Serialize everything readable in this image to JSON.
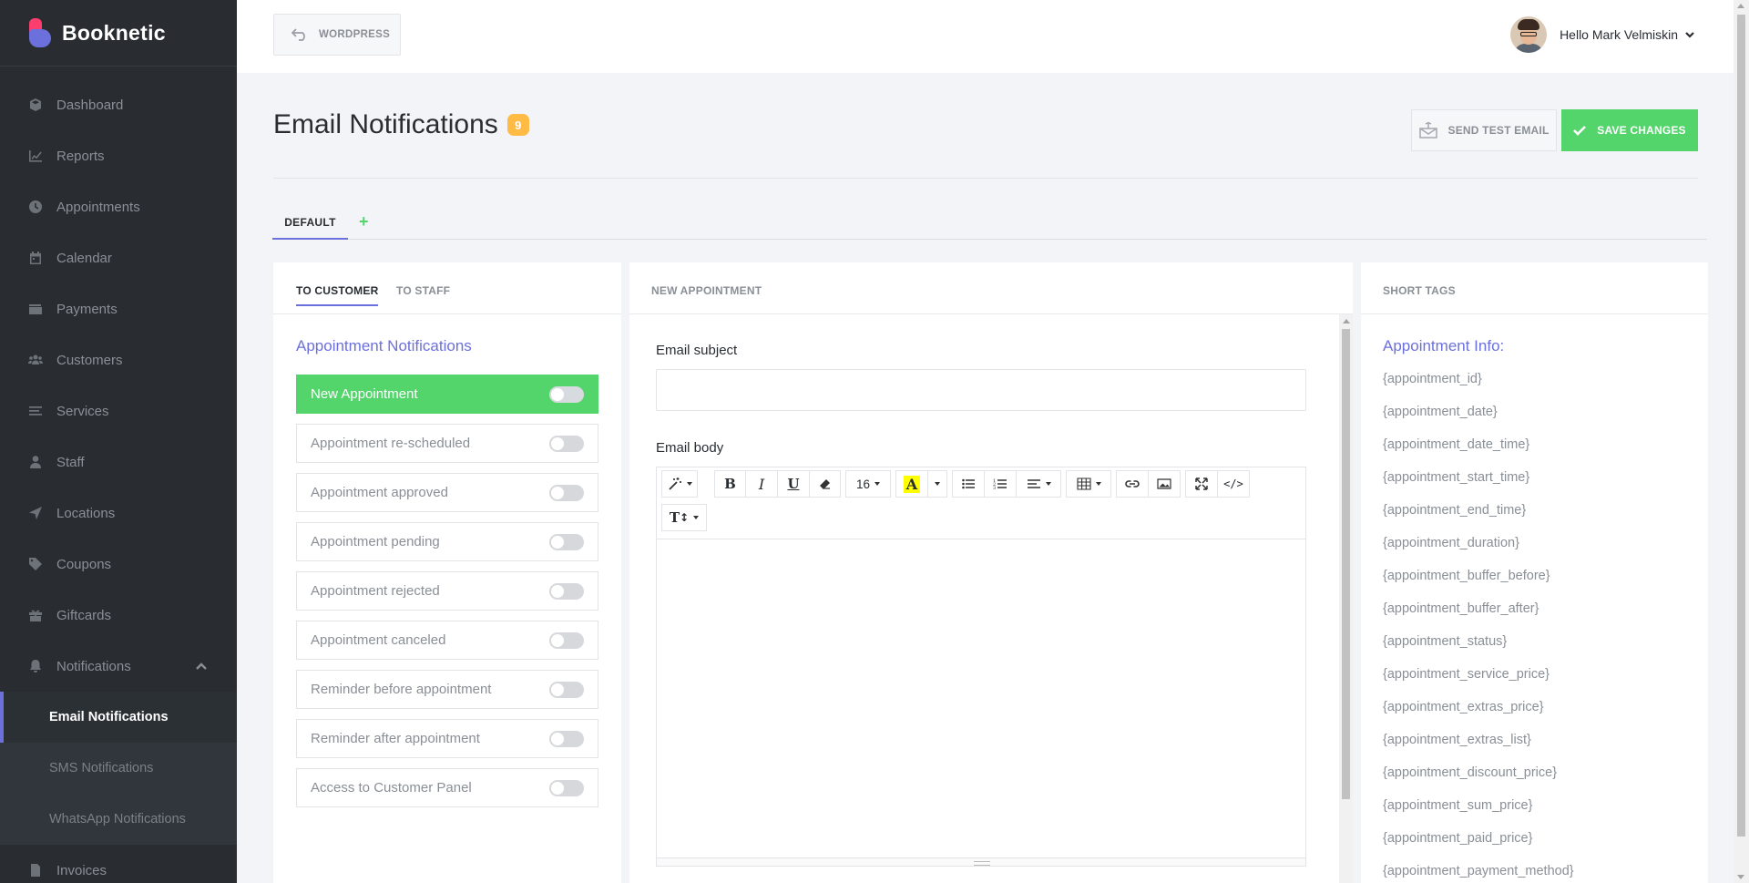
{
  "brand": {
    "name": "Booknetic"
  },
  "sidebar": {
    "items": [
      {
        "label": "Dashboard",
        "icon": "cube-icon"
      },
      {
        "label": "Reports",
        "icon": "chart-line-icon"
      },
      {
        "label": "Appointments",
        "icon": "clock-icon"
      },
      {
        "label": "Calendar",
        "icon": "calendar-icon"
      },
      {
        "label": "Payments",
        "icon": "wallet-icon"
      },
      {
        "label": "Customers",
        "icon": "users-icon"
      },
      {
        "label": "Services",
        "icon": "list-icon"
      },
      {
        "label": "Staff",
        "icon": "user-icon"
      },
      {
        "label": "Locations",
        "icon": "location-arrow-icon"
      },
      {
        "label": "Coupons",
        "icon": "tag-icon"
      },
      {
        "label": "Giftcards",
        "icon": "gift-icon"
      },
      {
        "label": "Notifications",
        "icon": "bell-icon"
      }
    ],
    "subitems": [
      {
        "label": "Email Notifications",
        "active": true
      },
      {
        "label": "SMS Notifications",
        "active": false
      },
      {
        "label": "WhatsApp Notifications",
        "active": false
      }
    ],
    "after": {
      "label": "Invoices",
      "icon": "file-icon"
    }
  },
  "topbar": {
    "wordpress_label": "WORDPRESS",
    "user_greeting": "Hello Mark Velmiskin"
  },
  "page": {
    "title": "Email Notifications",
    "count": "9",
    "send_test_label": "SEND TEST EMAIL",
    "save_label": "SAVE CHANGES"
  },
  "tabs": {
    "default_label": "DEFAULT",
    "add_label": "+"
  },
  "left_panel": {
    "tab_customer": "TO CUSTOMER",
    "tab_staff": "TO STAFF",
    "section_title": "Appointment Notifications",
    "notifications": [
      {
        "label": "New Appointment",
        "active": true
      },
      {
        "label": "Appointment re-scheduled",
        "active": false
      },
      {
        "label": "Appointment approved",
        "active": false
      },
      {
        "label": "Appointment pending",
        "active": false
      },
      {
        "label": "Appointment rejected",
        "active": false
      },
      {
        "label": "Appointment canceled",
        "active": false
      },
      {
        "label": "Reminder before appointment",
        "active": false
      },
      {
        "label": "Reminder after appointment",
        "active": false
      },
      {
        "label": "Access to Customer Panel",
        "active": false
      }
    ]
  },
  "mid_panel": {
    "header": "NEW APPOINTMENT",
    "subject_label": "Email subject",
    "subject_value": "",
    "body_label": "Email body",
    "font_size": "16",
    "toolbar_icons": [
      "magic-icon",
      "bold-icon",
      "italic-icon",
      "underline-icon",
      "eraser-icon",
      "font-size-icon",
      "font-color-icon",
      "unordered-list-icon",
      "ordered-list-icon",
      "align-icon",
      "table-icon",
      "link-icon",
      "image-icon",
      "fullscreen-icon",
      "code-view-icon",
      "line-height-icon"
    ]
  },
  "right_panel": {
    "header": "SHORT TAGS",
    "section_title": "Appointment Info:",
    "tags": [
      "{appointment_id}",
      "{appointment_date}",
      "{appointment_date_time}",
      "{appointment_start_time}",
      "{appointment_end_time}",
      "{appointment_duration}",
      "{appointment_buffer_before}",
      "{appointment_buffer_after}",
      "{appointment_status}",
      "{appointment_service_price}",
      "{appointment_extras_price}",
      "{appointment_extras_list}",
      "{appointment_discount_price}",
      "{appointment_sum_price}",
      "{appointment_paid_price}",
      "{appointment_payment_method}"
    ]
  },
  "colors": {
    "sidebar_bg": "#292d32",
    "accent": "#6c70dc",
    "success": "#53d56c",
    "badge": "#ffbb44",
    "page_bg": "#f3f4f8"
  }
}
